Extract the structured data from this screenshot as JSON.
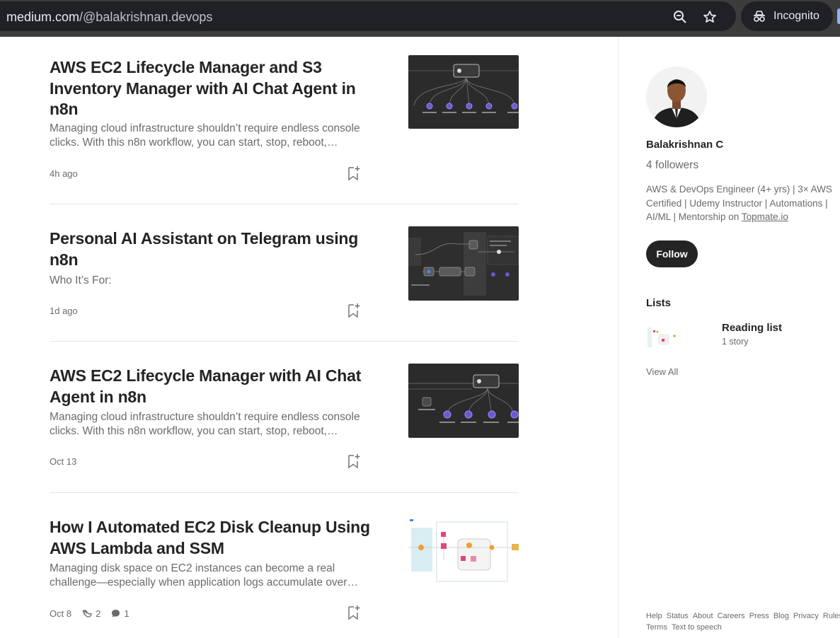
{
  "browser": {
    "url_host": "medium.com",
    "url_path": "/@balakrishnan.devops",
    "incognito_label": "Incognito",
    "icons": [
      "zoom-out-icon",
      "star-icon",
      "incognito-icon"
    ]
  },
  "posts": [
    {
      "title": "AWS EC2 Lifecycle Manager and S3 Inventory Manager with AI Chat Agent in n8n",
      "excerpt": "Managing cloud infrastructure shouldn’t require endless console clicks. With this n8n workflow, you can start, stop, reboot,…",
      "date": "4h ago"
    },
    {
      "title": "Personal AI Assistant on Telegram using n8n",
      "excerpt": "Who It’s For:",
      "date": "1d ago"
    },
    {
      "title": "AWS EC2 Lifecycle Manager with AI Chat Agent in n8n",
      "excerpt": "Managing cloud infrastructure shouldn’t require endless console clicks.  With this n8n workflow, you can start, stop, reboot,…",
      "date": "Oct 13"
    },
    {
      "title": "How I Automated EC2 Disk Cleanup Using AWS Lambda and SSM",
      "excerpt": "Managing disk space on EC2 instances can become a real challenge—especially when application logs accumulate over…",
      "date": "Oct 8",
      "claps": "2",
      "responses": "1"
    }
  ],
  "profile": {
    "name": "Balakrishnan C",
    "followers": "4 followers",
    "bio_text": "AWS & DevOps Engineer (4+ yrs) | 3× AWS Certified | Udemy Instructor | Automations | AI/ML | Mentorship on ",
    "bio_link": "Topmate.io",
    "follow_label": "Follow"
  },
  "lists": {
    "heading": "Lists",
    "items": [
      {
        "name": "Reading list",
        "count": "1 story"
      }
    ],
    "view_all": "View All"
  },
  "footer": {
    "links": [
      "Help",
      "Status",
      "About",
      "Careers",
      "Press",
      "Blog",
      "Privacy",
      "Rules",
      "Terms",
      "Text to speech"
    ]
  },
  "colors": {
    "chrome_bg": "#3c3c3c",
    "urlbar_bg": "#202124",
    "text_primary": "#242424",
    "text_secondary": "#6b6b6b",
    "thumb_dark": "#2d2d2d",
    "follow_bg": "#242424"
  }
}
